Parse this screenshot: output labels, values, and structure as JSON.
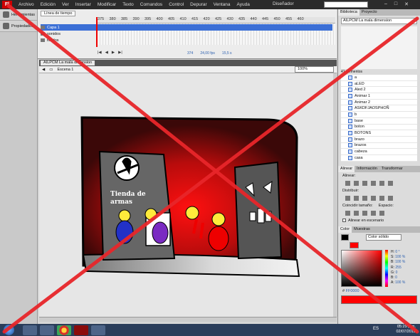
{
  "menubar": {
    "logo": "Fl",
    "items": [
      "Archivo",
      "Edición",
      "Ver",
      "Insertar",
      "Modificar",
      "Texto",
      "Comandos",
      "Control",
      "Depurar",
      "Ventana",
      "Ayuda"
    ],
    "workspace": "Diseñador"
  },
  "left_panel": {
    "items": [
      "Herramientas",
      "Propiedades"
    ]
  },
  "timeline": {
    "tab": "Línea de tiempo",
    "ruler": [
      "375",
      "380",
      "385",
      "390",
      "395",
      "400",
      "405",
      "410",
      "415",
      "420",
      "425",
      "430",
      "435",
      "440",
      "445",
      "450",
      "455",
      "460"
    ],
    "layers": [
      "Capa 1",
      "sonidos",
      "fondos"
    ],
    "status": {
      "frame": "374",
      "fps": "24,00 fps",
      "time": "15,5 s"
    }
  },
  "document": {
    "tab": "AILPCM La mala dimension",
    "scene": "Escena 1",
    "zoom": "100%"
  },
  "stage": {
    "shop_sign_line1": "Tienda de",
    "shop_sign_line2": "armas"
  },
  "right_panel": {
    "tabs": [
      "Biblioteca",
      "Proyecto"
    ],
    "library_select": "AILPCM La mala dimension",
    "library_count": "41 elementos",
    "library_items": [
      "a",
      "aLED",
      "Aled 2",
      "Animar 1",
      "Animar 2",
      "ASKDFJAOSPHOÑ",
      "b",
      "base",
      "boton",
      "BOTONS",
      "brazo",
      "brazos",
      "cabeza",
      "casa"
    ],
    "align_tabs": [
      "Alinear",
      "Información",
      "Transformar"
    ],
    "align_labels": [
      "Alinear:",
      "Distribuir:",
      "Coincidir tamaño:",
      "Espacio:"
    ],
    "align_stage": "Alinear en escenario",
    "color_tabs": [
      "Color",
      "Muestras"
    ],
    "color_type": "Color sólido",
    "color_fields": [
      {
        "k": "H:",
        "v": "0 °"
      },
      {
        "k": "S:",
        "v": "100 %"
      },
      {
        "k": "B:",
        "v": "100 %"
      },
      {
        "k": "R:",
        "v": "255"
      },
      {
        "k": "G:",
        "v": "0"
      },
      {
        "k": "B:",
        "v": "0"
      },
      {
        "k": "A:",
        "v": "100 %"
      }
    ],
    "hex": "FF0000"
  },
  "taskbar": {
    "lang": "ES",
    "time": "05:29 p.m.",
    "date": "02/07/2013"
  },
  "colors": {
    "accent": "#3b6fd6",
    "red": "#ff0000",
    "cross": "#e8262a"
  }
}
